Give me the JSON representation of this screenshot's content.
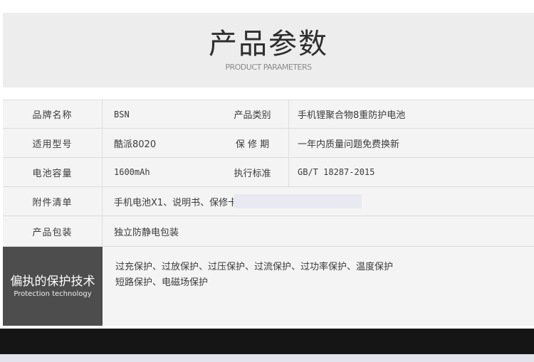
{
  "header": {
    "title": "产品参数",
    "subtitle": "PRODUCT PARAMETERS"
  },
  "rows": [
    {
      "label": "品牌名称",
      "value": "BSN",
      "label2": "产品类别",
      "value2": "手机锂聚合物8重防护电池"
    },
    {
      "label": "适用型号",
      "value": "酷派8020",
      "label2": "保 修 期",
      "value2": "一年内质量问题免费换新"
    },
    {
      "label": "电池容量",
      "value": "1600mAh",
      "label2": "执行标准",
      "value2": "GB/T 18287-2015"
    },
    {
      "label": "附件清单",
      "value": "手机电池X1、说明书、保修卡；"
    },
    {
      "label": "产品包装",
      "value": "独立防静电包装"
    }
  ],
  "protection": {
    "title": "偏执的保护技术",
    "subtitle": "Protection technology",
    "line1": "过充保护、过放保护、过压保护、过流保护、过功率保护、温度保护",
    "line2": "短路保护、电磁场保护"
  },
  "colors": {
    "header_bg": "#ededed",
    "table_bg": "#f4f4f4",
    "tech_label_bg": "#4d4d4d",
    "footer_bar": "#151515"
  }
}
